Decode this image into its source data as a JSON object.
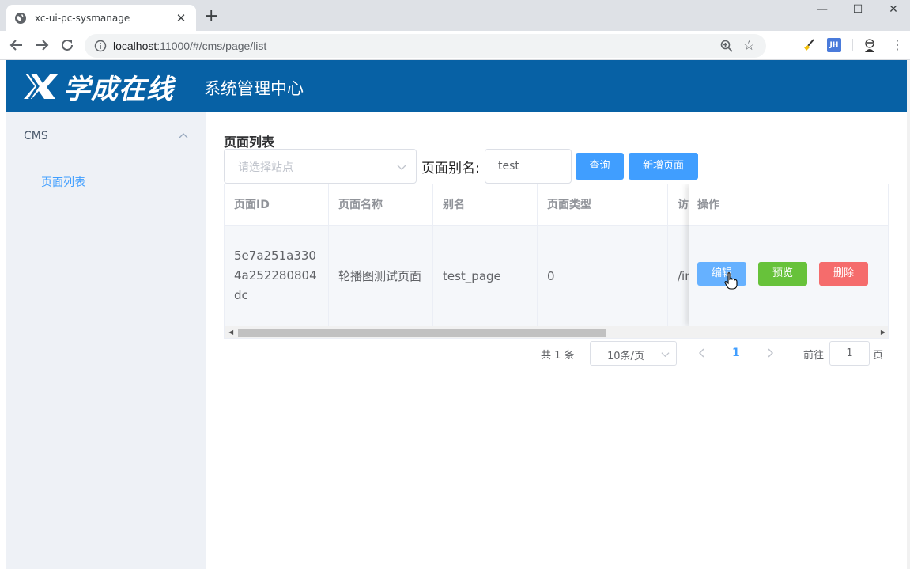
{
  "browser": {
    "tab_title": "xc-ui-pc-sysmanage",
    "url_host": "localhost",
    "url_rest": ":11000/#/cms/page/list",
    "window_controls": {
      "minimize": "—",
      "maximize": "☐",
      "close": "✕"
    },
    "ext_jh": "JH"
  },
  "header": {
    "logo_text": "学成在线",
    "subtitle": "系统管理中心",
    "bg_color": "#0761a5"
  },
  "sidebar": {
    "group_label": "CMS",
    "items": [
      {
        "label": "页面列表",
        "active": true
      }
    ]
  },
  "main": {
    "heading": "页面列表",
    "site_select_placeholder": "请选择站点",
    "alias_label": "页面别名:",
    "alias_value": "test",
    "query_button": "查询",
    "add_button": "新增页面"
  },
  "table": {
    "columns": [
      "页面ID",
      "页面名称",
      "别名",
      "页面类型",
      "访",
      "操作"
    ],
    "rows": [
      {
        "id": "5e7a251a3304a252280804dc",
        "name": "轮播图测试页面",
        "alias": "test_page",
        "type": "0",
        "access": "/in"
      }
    ],
    "actions": {
      "edit": "编辑",
      "preview": "预览",
      "delete": "删除"
    }
  },
  "pagination": {
    "total_text": "共 1 条",
    "page_size": "10条/页",
    "current_page": "1",
    "goto_label": "前往",
    "goto_value": "1",
    "page_suffix": "页"
  }
}
